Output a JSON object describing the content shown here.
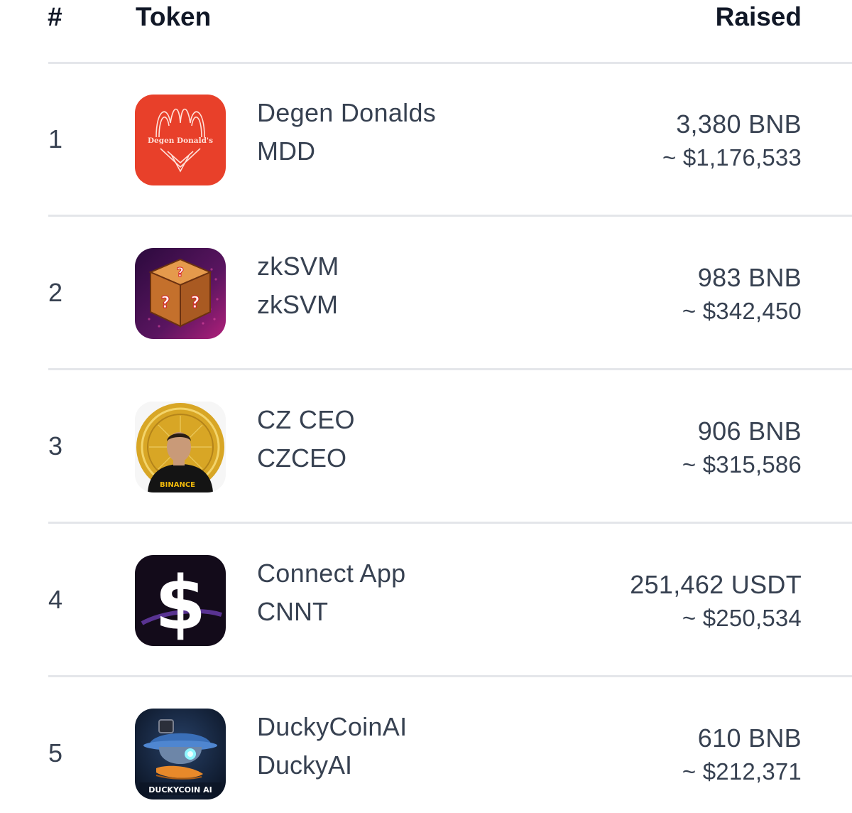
{
  "header": {
    "rank": "#",
    "token": "Token",
    "raised": "Raised"
  },
  "rows": [
    {
      "rank": "1",
      "name": "Degen Donalds",
      "symbol": "MDD",
      "amount": "3,380 BNB",
      "usd": "~ $1,176,533",
      "icon": "degen-donalds-logo-icon",
      "icon_text": "Degen Donald's",
      "color": "#e8402a"
    },
    {
      "rank": "2",
      "name": "zkSVM",
      "symbol": "zkSVM",
      "amount": "983 BNB",
      "usd": "~ $342,450",
      "icon": "mystery-box-icon",
      "color": "#4a1350"
    },
    {
      "rank": "3",
      "name": "CZ CEO",
      "symbol": "CZCEO",
      "amount": "906 BNB",
      "usd": "~ $315,586",
      "icon": "cz-coin-icon",
      "icon_text": "BINANCE",
      "color": "#d4a52a"
    },
    {
      "rank": "4",
      "name": "Connect App",
      "symbol": "CNNT",
      "amount": "251,462 USDT",
      "usd": "~ $250,534",
      "icon": "dollar-sign-icon",
      "color": "#120a18"
    },
    {
      "rank": "5",
      "name": "DuckyCoinAI",
      "symbol": "DuckyAI",
      "amount": "610 BNB",
      "usd": "~ $212,371",
      "icon": "ducky-robot-icon",
      "icon_text": "DUCKYCOIN AI",
      "color": "#0e1a2e"
    }
  ]
}
